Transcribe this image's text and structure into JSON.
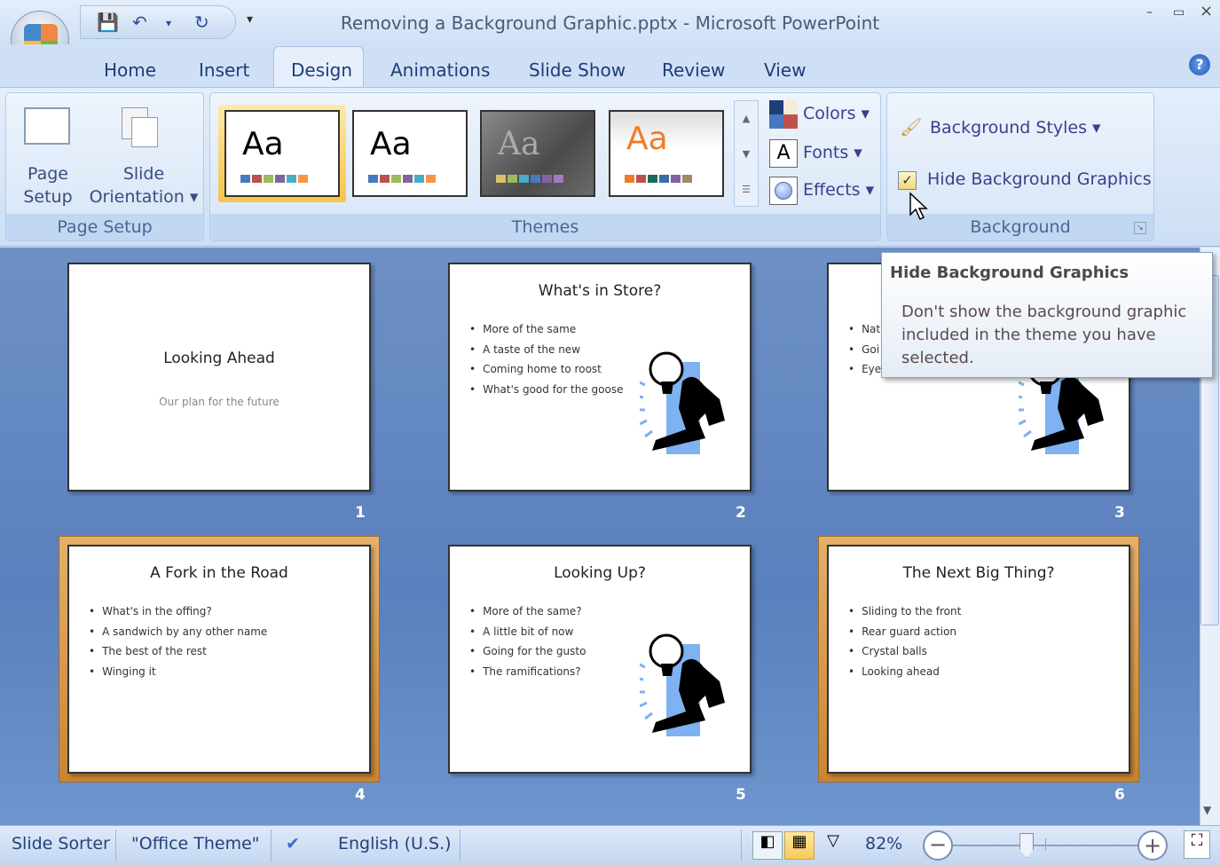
{
  "window": {
    "title": "Removing a Background Graphic.pptx - Microsoft PowerPoint",
    "minimize": "–",
    "restore": "▭",
    "close": "×"
  },
  "qat": {
    "save": "💾",
    "undo": "↶",
    "undo_drop": "▾",
    "redo": "↻",
    "customize": "▾"
  },
  "tabs": [
    "Home",
    "Insert",
    "Design",
    "Animations",
    "Slide Show",
    "Review",
    "View"
  ],
  "help": "?",
  "ribbon": {
    "page_setup": {
      "label": "Page Setup",
      "page_setup_btn": [
        "Page",
        "Setup"
      ],
      "orientation_btn": [
        "Slide",
        "Orientation ▾"
      ]
    },
    "themes": {
      "label": "Themes",
      "thumb_text": "Aa",
      "swatches": [
        [
          "#4a78c0",
          "#c0504d",
          "#9bbb59",
          "#8064a2",
          "#4bacc6",
          "#f79646"
        ],
        [
          "#4a78c0",
          "#c0504d",
          "#9bbb59",
          "#8064a2",
          "#4bacc6",
          "#f79646"
        ],
        [
          "#d8c36a",
          "#9bbb59",
          "#4bacc6",
          "#4a78c0",
          "#8064a2",
          "#a07cc0"
        ],
        [
          "#f07c28",
          "#c0504d",
          "#1f6b5a",
          "#3c6ca8",
          "#8064a2",
          "#9b8b6a"
        ]
      ],
      "colors": "Colors ▾",
      "fonts": "Fonts ▾",
      "effects": "Effects ▾"
    },
    "background": {
      "label": "Background",
      "styles": "Background Styles ▾",
      "hide_graphics": "Hide Background Graphics",
      "hide_graphics_checked": true
    }
  },
  "tooltip": {
    "title": "Hide Background Graphics",
    "body": "Don't show the background graphic included in the theme you have selected."
  },
  "slides": [
    {
      "num": "1",
      "title": "Looking Ahead",
      "subtitle": "Our plan for the future",
      "bullets": []
    },
    {
      "num": "2",
      "title": "What's in Store?",
      "bullets": [
        "More of the same",
        "A taste of the new",
        "Coming home to roost",
        "What's good for the goose"
      ]
    },
    {
      "num": "3",
      "title": "",
      "bullets": [
        "Nat",
        "Goi",
        "Eyes"
      ]
    },
    {
      "num": "4",
      "title": "A Fork in the Road",
      "bullets": [
        "What's in the offing?",
        "A sandwich by any other name",
        "The best of the rest",
        "Winging it"
      ]
    },
    {
      "num": "5",
      "title": "Looking Up?",
      "bullets": [
        "More of the same?",
        "A little bit of now",
        "Going for the gusto",
        "The ramifications?"
      ]
    },
    {
      "num": "6",
      "title": "The Next Big Thing?",
      "bullets": [
        "Sliding to the front",
        "Rear guard action",
        "Crystal balls",
        "Looking ahead"
      ]
    }
  ],
  "selected_slides": [
    "4",
    "6"
  ],
  "status": {
    "view": "Slide Sorter",
    "theme": "\"Office Theme\"",
    "language": "English (U.S.)",
    "zoom": "82%",
    "zoom_percent": 82
  }
}
